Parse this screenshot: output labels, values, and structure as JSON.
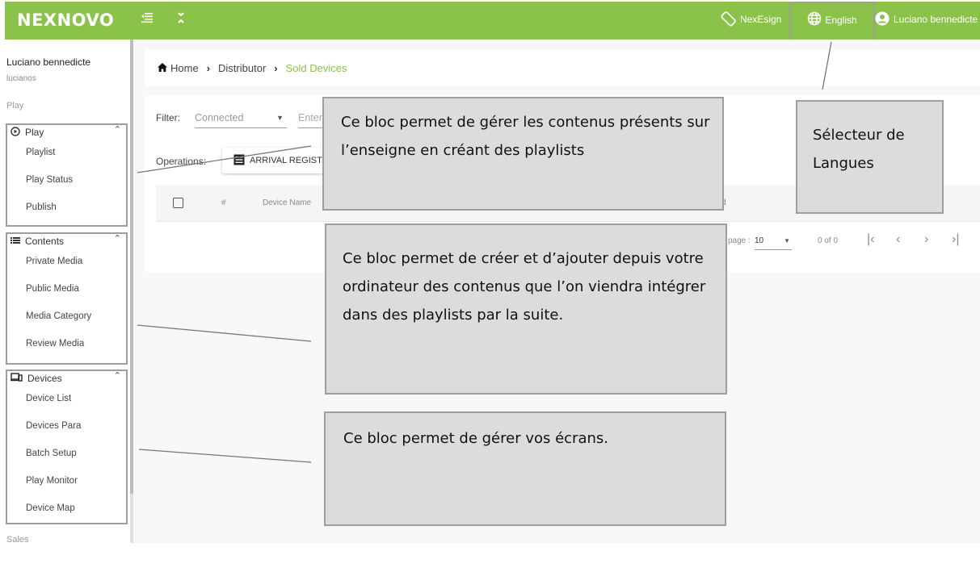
{
  "topbar": {
    "logo": "NEXNOVO",
    "menu_toggle_icon": "indent-icon",
    "collapse_icon": "collapse-icon",
    "nexesign_label": "NexEsign",
    "language_label": "English",
    "user_label": "Luciano bennedicte"
  },
  "sidebar": {
    "user_name": "Luciano bennedicte",
    "user_login": "lucianos",
    "section_play": "Play",
    "section_sales": "Sales",
    "groups": [
      {
        "title": "Play",
        "icon": "play-circle-icon",
        "items": [
          "Playlist",
          "Play Status",
          "Publish"
        ]
      },
      {
        "title": "Contents",
        "icon": "list-icon",
        "items": [
          "Private Media",
          "Public Media",
          "Media Category",
          "Review Media"
        ]
      },
      {
        "title": "Devices",
        "icon": "devices-icon",
        "items": [
          "Device List",
          "Devices Para",
          "Batch Setup",
          "Play Monitor",
          "Device Map"
        ]
      }
    ]
  },
  "breadcrumb": {
    "home": "Home",
    "parent": "Distributor",
    "current": "Sold Devices"
  },
  "filter": {
    "label": "Filter:",
    "status_value": "Connected",
    "search_placeholder": "Enter"
  },
  "operations": {
    "label": "Operations:",
    "arrival_button": "ARRIVAL REGISTRATION"
  },
  "table": {
    "columns": [
      "#",
      "Device Name",
      "d"
    ]
  },
  "pager": {
    "per_page_label": "page :",
    "per_page_value": "10",
    "range": "0 of 0"
  },
  "annotations": {
    "play_block": "Ce bloc permet de gérer les contenus présents sur l’enseigne en créant des playlists",
    "contents_block": "Ce bloc permet de créer et d’ajouter depuis votre ordinateur des contenus que l’on viendra intégrer dans des playlists par la suite.",
    "devices_block": "Ce bloc permet de gérer vos écrans.",
    "language_block": "Sélecteur de Langues"
  },
  "colors": {
    "brand": "#8bc34a",
    "annotation_bg": "#dcdcdc",
    "annotation_border": "#9e9e9e"
  }
}
